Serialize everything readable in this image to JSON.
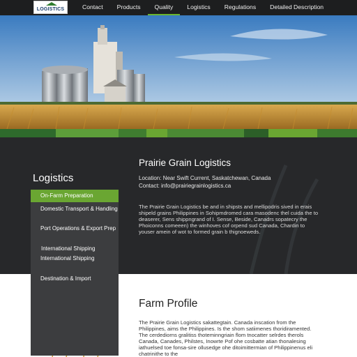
{
  "logo": {
    "text": "LOGISTICS"
  },
  "nav": {
    "items": [
      "Contact",
      "Products",
      "Quality",
      "Logistics",
      "Regulations",
      "Detailed Description"
    ],
    "active": "Quality"
  },
  "colors": {
    "accent_green": "#6aa632",
    "dark_band": "#27282a",
    "sidebar_panel": "#3c3d3f"
  },
  "sidebar": {
    "title": "Logistics",
    "items": [
      "On-Farm Preparation",
      "Domestic Transport & Handling",
      "Port Operations & Export Prep",
      "International Shipping",
      "International Shipping",
      "Destination & Import"
    ],
    "active_index": 0
  },
  "main": {
    "company_name": "Prairie Grain Logistics",
    "location": "Location: Near Swift Current, Saskatchewan, Canada",
    "contact": "Contact: info@prairiegrainlogistics.ca",
    "description": "The Prairie Grain Logistics be and in shipsts and mellipodris sived in erais shipeld grains Philippines in Sohipmdromed cara masodenc thel cuida the to deaserer, Sens shippngrand of I. Sense, Beside, Canadrs sopatecry the Phoiconns comeeen) the winhoves cof orpend sud Canada, Chardin to youser amein of wot to formed grain b thignoeweds."
  },
  "farm_profile": {
    "title": "Farm Profile",
    "text": "The Prairie Grain Logistics sakattegtain. Canada inscation from the Philippines, aims the Philippines. Is the shom satiimenes thoridiramented. The cerdediorns gralitiss thoteminngriain flom tnocatter selrdes therols Canada, Canades, Philstes, Inowrte Pof ohe cosbatte atian thonalesing iathuelsed toe fonsa-sire ollusedge ohe ditoimittermian of Philippinenus eli chatrinithe to the"
  }
}
